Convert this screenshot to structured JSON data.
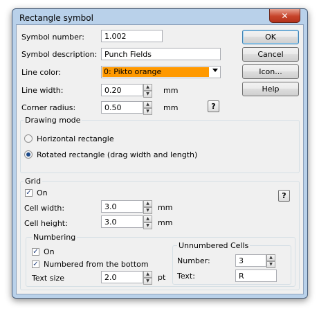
{
  "window": {
    "title": "Rectangle symbol",
    "close_glyph": "✕"
  },
  "buttons": {
    "ok": "OK",
    "cancel": "Cancel",
    "icon": "Icon...",
    "help": "Help",
    "help_glyph": "?"
  },
  "fields": {
    "symbol_number": {
      "label": "Symbol number:",
      "value": "1.002"
    },
    "symbol_description": {
      "label": "Symbol description:",
      "value": "Punch Fields"
    },
    "line_color": {
      "label": "Line color:",
      "value": "0: Pikto orange",
      "swatch": "#ff9900"
    },
    "line_width": {
      "label": "Line width:",
      "value": "0.20",
      "unit": "mm"
    },
    "corner_radius": {
      "label": "Corner radius:",
      "value": "0.50",
      "unit": "mm"
    }
  },
  "drawing_mode": {
    "title": "Drawing mode",
    "options": [
      {
        "label": "Horizontal rectangle",
        "selected": false
      },
      {
        "label": "Rotated rectangle (drag width and length)",
        "selected": true
      }
    ]
  },
  "grid": {
    "title": "Grid",
    "on_label": "On",
    "on_checked": true,
    "cell_width": {
      "label": "Cell width:",
      "value": "3.0",
      "unit": "mm"
    },
    "cell_height": {
      "label": "Cell height:",
      "value": "3.0",
      "unit": "mm"
    }
  },
  "numbering": {
    "title": "Numbering",
    "on_label": "On",
    "from_bottom_label": "Numbered from the bottom",
    "text_size": {
      "label": "Text size",
      "value": "2.0",
      "unit": "pt"
    }
  },
  "unnumbered": {
    "title": "Unnumbered Cells",
    "number": {
      "label": "Number:",
      "value": "3"
    },
    "text": {
      "label": "Text:",
      "value": "R"
    }
  }
}
